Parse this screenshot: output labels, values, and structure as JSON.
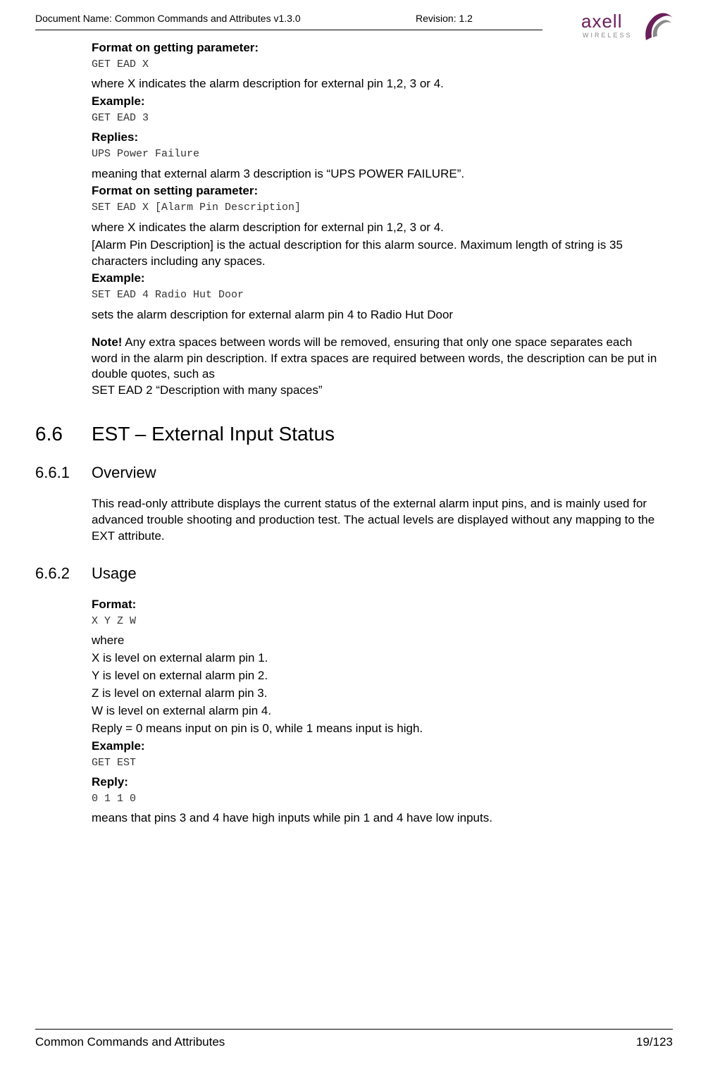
{
  "header": {
    "doc_name_label": "Document Name: Common Commands and Attributes v1.3.0",
    "revision_label": "Revision: 1.2",
    "logo_brand": "axell",
    "logo_sub": "WIRELESS"
  },
  "s1": {
    "format_get_label": "Format on getting parameter:",
    "get_cmd": "GET EAD X",
    "get_desc": "where X indicates the alarm description for external pin 1,2, 3 or 4.",
    "example_label": "Example:",
    "get_example": "GET EAD 3",
    "replies_label": "Replies:",
    "replies_val": "UPS Power Failure",
    "replies_desc": "meaning that external alarm 3 description is “UPS POWER FAILURE”.",
    "format_set_label": "Format on setting parameter:",
    "set_cmd": "SET EAD X [Alarm Pin Description]",
    "set_desc1": "where X indicates the alarm description for external pin 1,2, 3 or 4.",
    "set_desc2": "[Alarm Pin Description] is the actual description for this alarm source. Maximum length of string is 35 characters including any spaces.",
    "set_example": "SET EAD 4 Radio Hut Door",
    "set_result": "sets the alarm description for external alarm pin 4 to Radio Hut Door",
    "note_label": "Note!",
    "note_text": " Any extra spaces between words will be removed, ensuring that only one space separates each word in the alarm pin description. If extra spaces are required between words, the description can be put in double quotes, such as",
    "note_example": "SET EAD 2 “Description with many     spaces”"
  },
  "h66": {
    "num": "6.6",
    "title": "EST – External Input Status"
  },
  "h661": {
    "num": "6.6.1",
    "title": "Overview",
    "body": "This read-only attribute displays the current status of the external alarm input pins, and is mainly used for advanced trouble shooting and production test. The actual levels are displayed without any mapping to the EXT attribute."
  },
  "h662": {
    "num": "6.6.2",
    "title": "Usage",
    "format_label": "Format:",
    "format_val": "X Y Z W",
    "where": "where",
    "l1": "X is level on external alarm pin 1.",
    "l2": "Y is level on external alarm pin 2.",
    "l3": "Z is level on external alarm pin 3.",
    "l4": "W is level on external alarm pin 4.",
    "reply_desc": "Reply = 0 means input on pin is 0, while 1 means input is high.",
    "example_label": "Example:",
    "example_cmd": "GET EST",
    "reply_label": "Reply:",
    "reply_val": "0 1 1 0",
    "reply_meaning": "means that pins 3 and 4 have high inputs while pin 1 and 4 have low inputs."
  },
  "footer": {
    "title": "Common Commands and Attributes",
    "page": "19/123"
  }
}
